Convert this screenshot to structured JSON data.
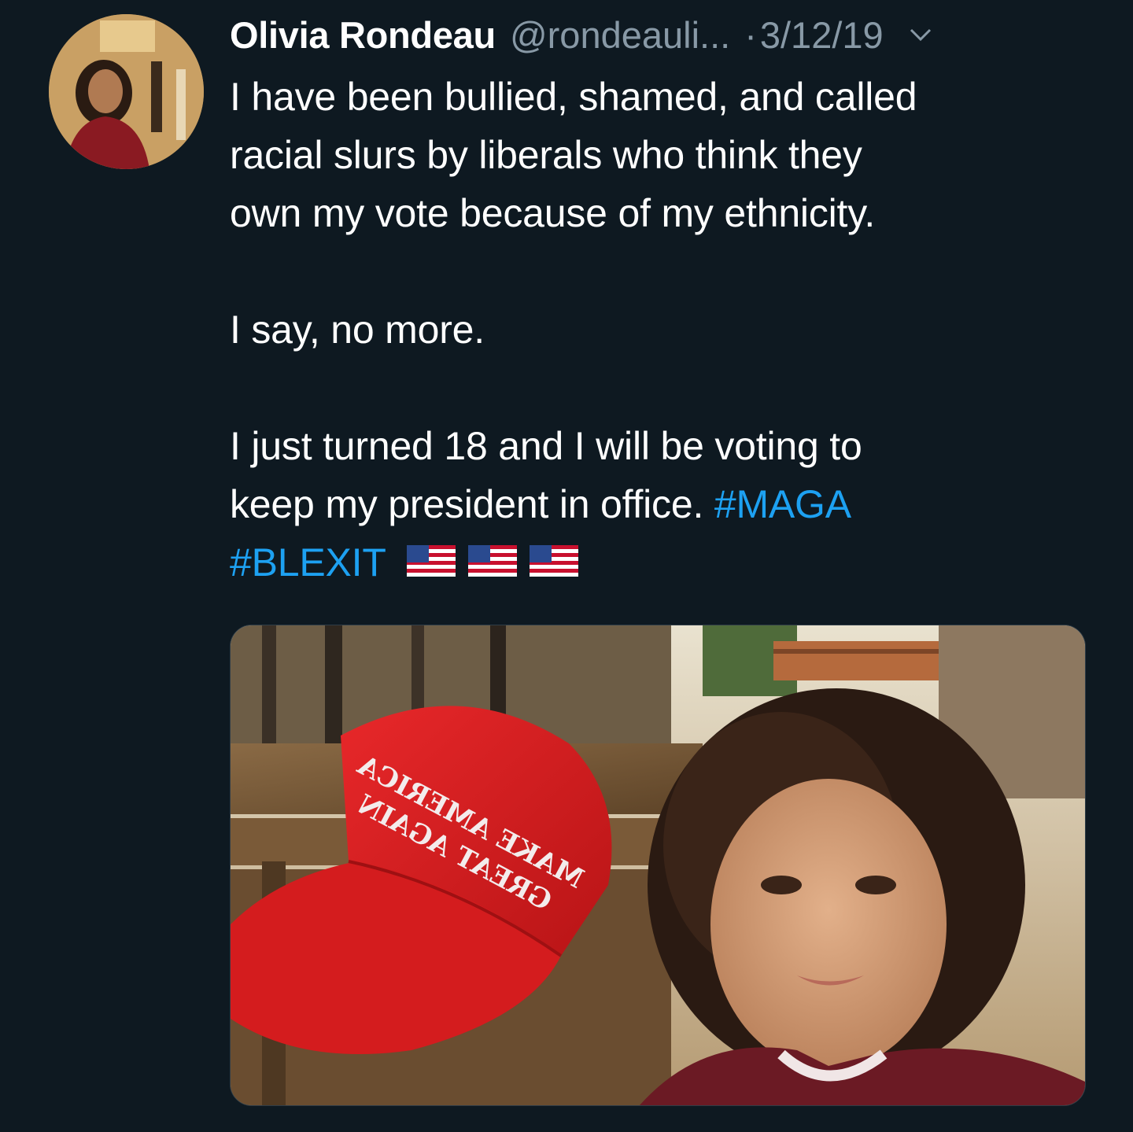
{
  "tweet": {
    "author": {
      "display_name": "Olivia Rondeau",
      "handle": "@rondeauli...",
      "avatar_icon": "profile-photo"
    },
    "separator": "·",
    "date": "3/12/19",
    "menu_icon": "chevron-down-icon",
    "text": {
      "lines_1": [
        "I have been bullied, shamed, and called",
        "racial slurs by liberals who think they",
        "own my vote because of my ethnicity."
      ],
      "paragraph_2": "I say, no more.",
      "paragraph_3_line_1": "I just turned 18 and I will be voting to",
      "paragraph_3_line_2": "keep my president in office.",
      "hashtags": [
        "#MAGA",
        "#BLEXIT"
      ],
      "emoji": [
        "us-flag",
        "us-flag",
        "us-flag"
      ]
    },
    "media": {
      "hat_line_1": "MAKE AMERICA",
      "hat_line_2": "GREAT AGAIN"
    },
    "colors": {
      "background": "#0e1921",
      "text": "#ffffff",
      "secondary": "#8899a6",
      "link": "#1da1f2"
    }
  }
}
